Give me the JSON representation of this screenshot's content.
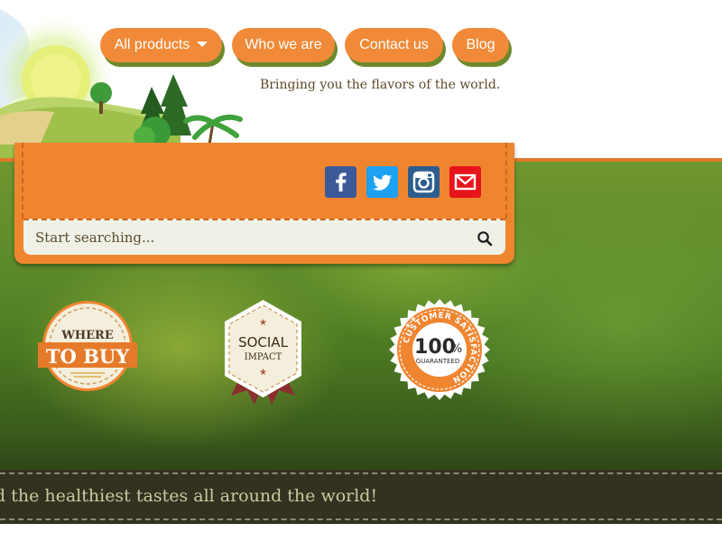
{
  "nav": {
    "items": [
      {
        "label": "All products",
        "has_dropdown": true
      },
      {
        "label": "Who we are"
      },
      {
        "label": "Contact us"
      },
      {
        "label": "Blog"
      }
    ]
  },
  "header": {
    "tagline": "Bringing you the flavors of the world."
  },
  "social": {
    "icons": [
      "facebook-icon",
      "twitter-icon",
      "instagram-icon",
      "email-icon"
    ]
  },
  "search": {
    "placeholder": "Start searching..."
  },
  "badges": {
    "where_to_buy": {
      "line1": "WHERE",
      "line2": "TO BUY"
    },
    "social_impact": {
      "line1": "SOCIAL",
      "line2": "IMPACT"
    },
    "customer_satisfaction": {
      "arc": "CUSTOMER SATISFACTION",
      "big": "100",
      "percent": "%",
      "small": "GUARANTEED"
    }
  },
  "ticker": {
    "text": "d the healthiest tastes all around the world!"
  },
  "colors": {
    "orange": "#f08530",
    "nav_shadow": "#6b8a2c",
    "ticker_bg": "#33311f",
    "ticker_text": "#ccc8a0"
  }
}
